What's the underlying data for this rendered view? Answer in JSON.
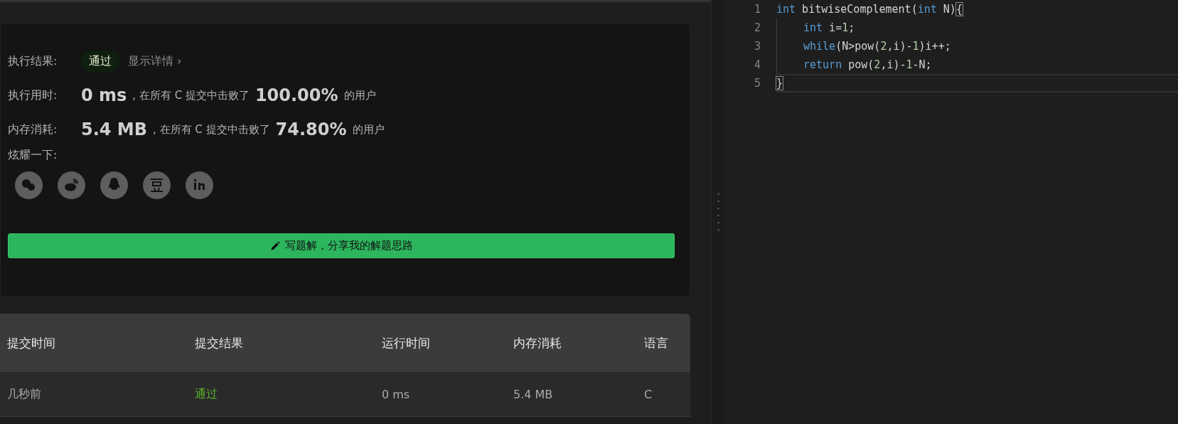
{
  "result": {
    "label": "执行结果:",
    "status": "通过",
    "details_link": "显示详情 ›"
  },
  "stats": [
    {
      "label": "执行用时:",
      "value": "0 ms",
      "middle": ", 在所有 C 提交中击败了",
      "percent": "100.00%",
      "suffix": "的用户"
    },
    {
      "label": "内存消耗:",
      "value": "5.4 MB",
      "middle": ", 在所有 C 提交中击败了",
      "percent": "74.80%",
      "suffix": "的用户"
    }
  ],
  "share": {
    "label": "炫耀一下:"
  },
  "write_button": "写题解，分享我的解题思路",
  "table": {
    "columns": [
      "提交时间",
      "提交结果",
      "运行时间",
      "内存消耗",
      "语言"
    ],
    "rows": [
      {
        "cells": [
          "几秒前",
          "通过",
          "0 ms",
          "5.4 MB",
          "C"
        ],
        "accepted": true
      }
    ]
  },
  "editor": {
    "lines": [
      {
        "number": "1",
        "current": false,
        "indented": false,
        "tokens": [
          {
            "text": "int",
            "kind": "keyword"
          },
          {
            "text": " bitwiseComplement(",
            "kind": "plain"
          },
          {
            "text": "int",
            "kind": "keyword"
          },
          {
            "text": " N)",
            "kind": "plain"
          },
          {
            "text": "{",
            "kind": "bracket"
          }
        ]
      },
      {
        "number": "2",
        "current": false,
        "indented": true,
        "tokens": [
          {
            "text": "int",
            "kind": "keyword"
          },
          {
            "text": " i=",
            "kind": "plain"
          },
          {
            "text": "1",
            "kind": "number"
          },
          {
            "text": ";",
            "kind": "plain"
          }
        ]
      },
      {
        "number": "3",
        "current": false,
        "indented": true,
        "tokens": [
          {
            "text": "while",
            "kind": "keyword"
          },
          {
            "text": "(N>pow(",
            "kind": "plain"
          },
          {
            "text": "2",
            "kind": "number"
          },
          {
            "text": ",i)-",
            "kind": "plain"
          },
          {
            "text": "1",
            "kind": "number"
          },
          {
            "text": ")i++;",
            "kind": "plain"
          }
        ]
      },
      {
        "number": "4",
        "current": false,
        "indented": true,
        "tokens": [
          {
            "text": "return",
            "kind": "keyword"
          },
          {
            "text": " pow(",
            "kind": "plain"
          },
          {
            "text": "2",
            "kind": "number"
          },
          {
            "text": ",i)-",
            "kind": "plain"
          },
          {
            "text": "1",
            "kind": "number"
          },
          {
            "text": "-N;",
            "kind": "plain"
          }
        ]
      },
      {
        "number": "5",
        "current": true,
        "indented": false,
        "tokens": [
          {
            "text": "}",
            "kind": "bracket"
          }
        ]
      }
    ]
  }
}
